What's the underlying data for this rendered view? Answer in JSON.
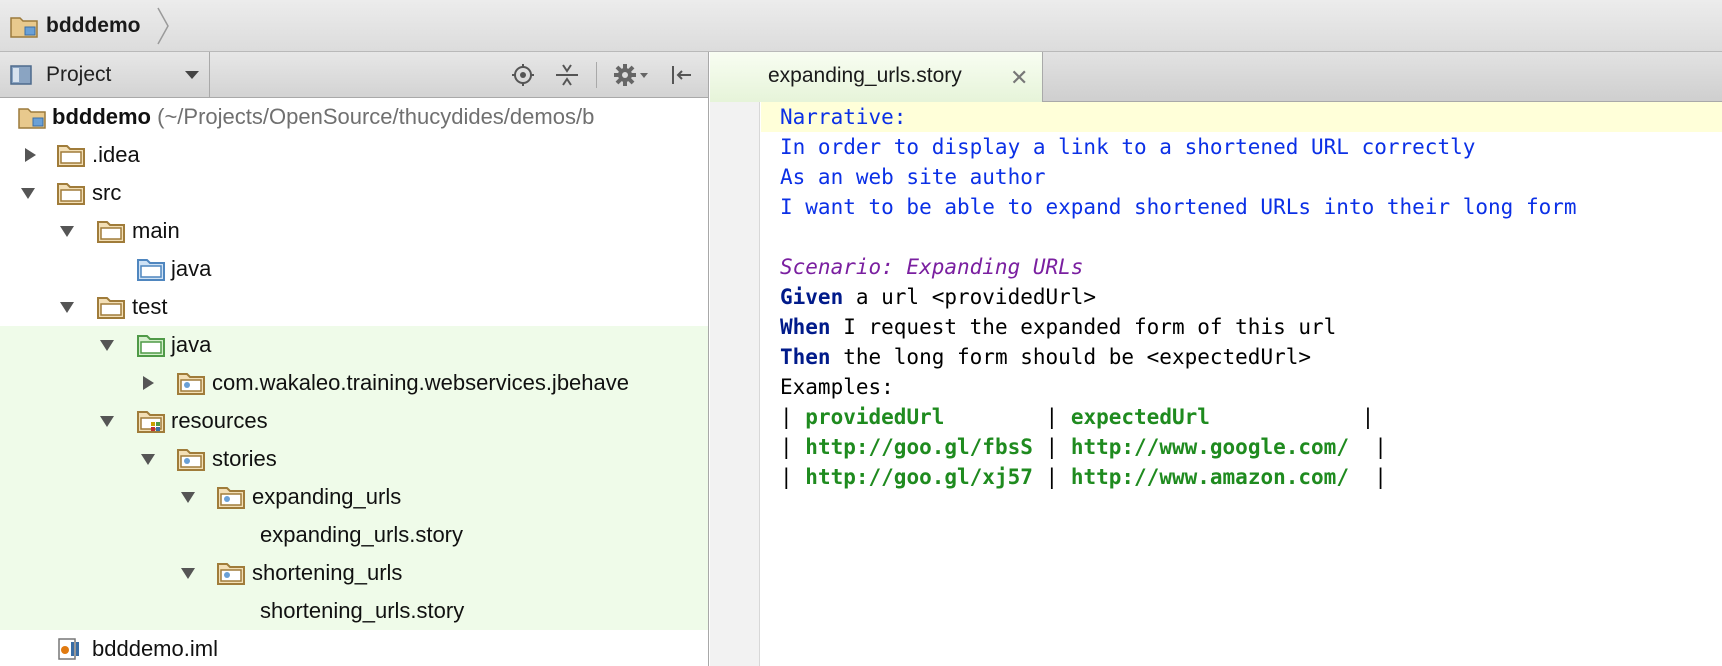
{
  "breadcrumb": {
    "project": "bdddemo"
  },
  "project_panel": {
    "view_label": "Project",
    "tools": [
      "locate-icon",
      "collapse-all-icon",
      "settings-icon",
      "hide-icon"
    ]
  },
  "tree": {
    "root_name": "bdddemo",
    "root_path": "(~/Projects/OpenSource/thucydides/demos/b",
    "idea": ".idea",
    "src": "src",
    "main": "main",
    "main_java": "java",
    "test": "test",
    "test_java": "java",
    "package": "com.wakaleo.training.webservices.jbehave",
    "resources": "resources",
    "stories": "stories",
    "expanding_dir": "expanding_urls",
    "expanding_file": "expanding_urls.story",
    "shortening_dir": "shortening_urls",
    "shortening_file": "shortening_urls.story",
    "iml": "bdddemo.iml"
  },
  "editor": {
    "tab_label": "expanding_urls.story",
    "tab_close": "✕",
    "narrative": {
      "l1": "Narrative:",
      "l2": "In order to display a link to a shortened URL correctly",
      "l3": "As an web site author",
      "l4": "I want to be able to expand shortened URLs into their long form"
    },
    "scenario": "Scenario: Expanding URLs",
    "given_kw": "Given",
    "given_text": " a url <providedUrl>",
    "when_kw": "When",
    "when_text": " I request the expanded form of this url",
    "then_kw": "Then",
    "then_text": " the long form should be <expectedUrl>",
    "examples": "Examples:",
    "table": {
      "header": [
        "providedUrl",
        "expectedUrl"
      ],
      "rows": [
        [
          "http://goo.gl/fbsS",
          "http://www.google.com/"
        ],
        [
          "http://goo.gl/xj57",
          "http://www.amazon.com/"
        ]
      ]
    }
  },
  "colors": {
    "narrative": "#0b30e6",
    "scenario": "#7a1fa0",
    "keyword": "#001a8a",
    "table_value": "#1f8b1f",
    "test_highlight": "#effbe9"
  }
}
